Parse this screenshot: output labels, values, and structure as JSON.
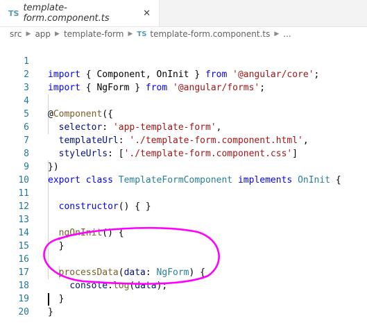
{
  "tab": {
    "badge": "TS",
    "label": "template-form.component.ts",
    "close": "✕"
  },
  "breadcrumb": {
    "items": [
      "src",
      "app",
      "template-form"
    ],
    "file_badge": "TS",
    "file": "template-form.component.ts",
    "ellipsis": "..."
  },
  "code": {
    "line_numbers": [
      "1",
      "2",
      "3",
      "4",
      "5",
      "6",
      "7",
      "8",
      "9",
      "10",
      "11",
      "12",
      "13",
      "14",
      "15",
      "16",
      "17",
      "18",
      "19",
      "20"
    ],
    "l1": {
      "kw1": "import",
      "t1": " { Component, OnInit } ",
      "kw2": "from",
      "s1": "'@angular/core'",
      "t2": ";"
    },
    "l2": {
      "kw1": "import",
      "t1": " { NgForm } ",
      "kw2": "from",
      "s1": "'@angular/forms'",
      "t2": ";"
    },
    "l4": {
      "t1": "@",
      "fn": "Component",
      "t2": "({"
    },
    "l5": {
      "p": "selector",
      "t1": ": ",
      "s1": "'app-template-form'",
      "t2": ","
    },
    "l6": {
      "p": "templateUrl",
      "t1": ": ",
      "s1": "'./template-form.component.html'",
      "t2": ","
    },
    "l7": {
      "p": "styleUrls",
      "t1": ": [",
      "s1": "'./template-form.component.css'",
      "t2": "]"
    },
    "l8": {
      "t1": "})"
    },
    "l9": {
      "kw1": "export",
      "kw2": "class",
      "cls": "TemplateFormComponent",
      "kw3": "implements",
      "iface": "OnInit",
      "t1": " {"
    },
    "l11": {
      "fn": "constructor",
      "t1": "() { }"
    },
    "l13": {
      "fn": "ngOnInit",
      "t1": "() {"
    },
    "l14": {
      "t1": "}"
    },
    "l16": {
      "fn": "processData",
      "t1": "(",
      "p": "data",
      "t2": ": ",
      "type": "NgForm",
      "t3": ") {"
    },
    "l17": {
      "obj": "console",
      "t1": ".",
      "fn": "log",
      "t2": "(",
      "p": "data",
      "t3": ");"
    },
    "l18": {
      "t1": "}"
    },
    "l19": {
      "t1": "}"
    }
  },
  "colors": {
    "keyword": "#0000ff",
    "string": "#a31515",
    "type": "#267f99",
    "function": "#795e26",
    "variable": "#001080",
    "line_number": "#237893",
    "annotation": "#ff00ff"
  }
}
